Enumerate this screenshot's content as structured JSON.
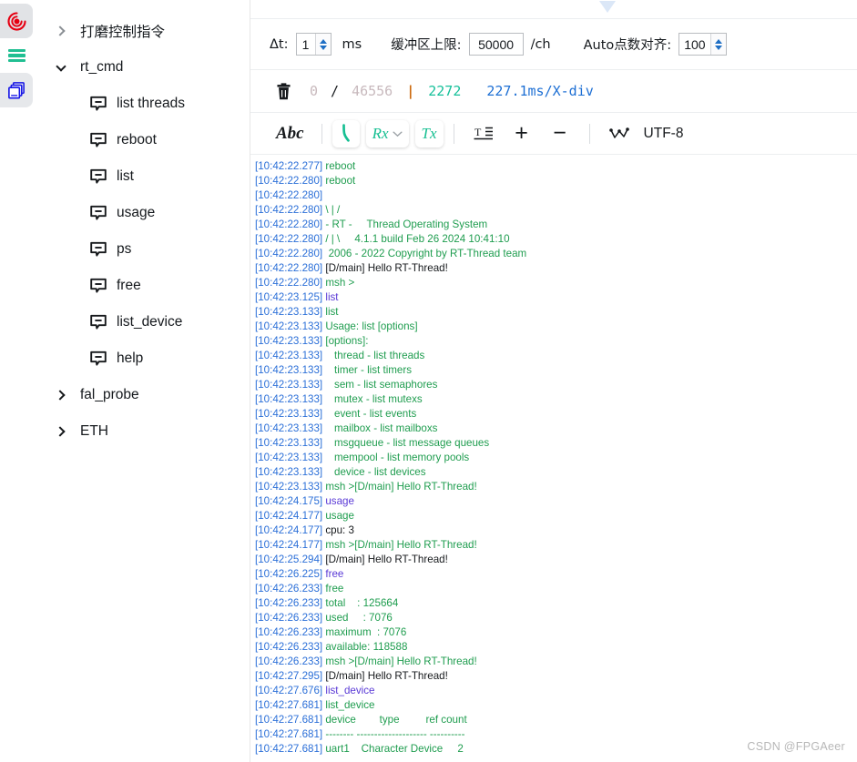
{
  "rail": {
    "items": [
      {
        "name": "record-target-icon",
        "title": "Record"
      },
      {
        "name": "menu-icon",
        "title": "Menu"
      },
      {
        "name": "layers-icon",
        "title": "Sessions"
      }
    ]
  },
  "sidebar": {
    "groups": [
      {
        "label": "打磨控制指令",
        "expanded": false,
        "children": []
      },
      {
        "label": "rt_cmd",
        "expanded": true,
        "children": [
          "list threads",
          "reboot",
          "list",
          "usage",
          "ps",
          "free",
          "list_device",
          "help"
        ]
      },
      {
        "label": "fal_probe",
        "expanded": false,
        "children": []
      },
      {
        "label": "ETH",
        "expanded": false,
        "children": []
      }
    ]
  },
  "settings_bar": {
    "dt_label": "Δt:",
    "dt_value": "1",
    "dt_unit": "ms",
    "buffer_label": "缓冲区上限:",
    "buffer_value": "50000",
    "buffer_unit": "/ch",
    "auto_label": "Auto点数对齐:",
    "auto_value": "100"
  },
  "counter_bar": {
    "trash_icon": "trash-icon",
    "current": "0",
    "slash": "/",
    "total": "46556",
    "pipe": "|",
    "selected": "2272",
    "timebase": "227.1ms/X-div"
  },
  "format_bar": {
    "abc_label": "Abc",
    "connect_icon": "phone-hook-icon",
    "rx_label": "Rx",
    "tx_label": "Tx",
    "wrap_icon": "text-align-icon",
    "zoom_in": "+",
    "zoom_out": "−",
    "plot_icon": "waveform-icon",
    "encoding": "UTF-8"
  },
  "terminal": {
    "lines": [
      {
        "ts": "[10:42:22.277]",
        "text": " reboot",
        "color": "green"
      },
      {
        "ts": "[10:42:22.280]",
        "text": " reboot",
        "color": "green"
      },
      {
        "ts": "[10:42:22.280]",
        "text": "",
        "color": "green"
      },
      {
        "ts": "[10:42:22.280]",
        "text": " \\ | /",
        "color": "green"
      },
      {
        "ts": "[10:42:22.280]",
        "text": " - RT -     Thread Operating System",
        "color": "green"
      },
      {
        "ts": "[10:42:22.280]",
        "text": " / | \\     4.1.1 build Feb 26 2024 10:41:10",
        "color": "green"
      },
      {
        "ts": "[10:42:22.280]",
        "text": "  2006 - 2022 Copyright by RT-Thread team",
        "color": "green"
      },
      {
        "ts": "[10:42:22.280]",
        "text": " [D/main] Hello RT-Thread!",
        "color": "black"
      },
      {
        "ts": "[10:42:22.280]",
        "text": " msh >",
        "color": "green"
      },
      {
        "ts": "[10:42:23.125]",
        "text": " list",
        "color": "purple"
      },
      {
        "ts": "[10:42:23.133]",
        "text": " list",
        "color": "green"
      },
      {
        "ts": "[10:42:23.133]",
        "text": " Usage: list [options]",
        "color": "green"
      },
      {
        "ts": "[10:42:23.133]",
        "text": " [options]:",
        "color": "green"
      },
      {
        "ts": "[10:42:23.133]",
        "text": "    thread - list threads",
        "color": "green"
      },
      {
        "ts": "[10:42:23.133]",
        "text": "    timer - list timers",
        "color": "green"
      },
      {
        "ts": "[10:42:23.133]",
        "text": "    sem - list semaphores",
        "color": "green"
      },
      {
        "ts": "[10:42:23.133]",
        "text": "    mutex - list mutexs",
        "color": "green"
      },
      {
        "ts": "[10:42:23.133]",
        "text": "    event - list events",
        "color": "green"
      },
      {
        "ts": "[10:42:23.133]",
        "text": "    mailbox - list mailboxs",
        "color": "green"
      },
      {
        "ts": "[10:42:23.133]",
        "text": "    msgqueue - list message queues",
        "color": "green"
      },
      {
        "ts": "[10:42:23.133]",
        "text": "    mempool - list memory pools",
        "color": "green"
      },
      {
        "ts": "[10:42:23.133]",
        "text": "    device - list devices",
        "color": "green"
      },
      {
        "ts": "[10:42:23.133]",
        "text": " msh >[D/main] Hello RT-Thread!",
        "color": "green"
      },
      {
        "ts": "[10:42:24.175]",
        "text": " usage",
        "color": "purple"
      },
      {
        "ts": "[10:42:24.177]",
        "text": " usage",
        "color": "green"
      },
      {
        "ts": "[10:42:24.177]",
        "text": " cpu: 3",
        "color": "black"
      },
      {
        "ts": "[10:42:24.177]",
        "text": " msh >[D/main] Hello RT-Thread!",
        "color": "green"
      },
      {
        "ts": "[10:42:25.294]",
        "text": " [D/main] Hello RT-Thread!",
        "color": "black"
      },
      {
        "ts": "[10:42:26.225]",
        "text": " free",
        "color": "purple"
      },
      {
        "ts": "[10:42:26.233]",
        "text": " free",
        "color": "green"
      },
      {
        "ts": "[10:42:26.233]",
        "text": " total    : 125664",
        "color": "green"
      },
      {
        "ts": "[10:42:26.233]",
        "text": " used     : 7076",
        "color": "green"
      },
      {
        "ts": "[10:42:26.233]",
        "text": " maximum  : 7076",
        "color": "green"
      },
      {
        "ts": "[10:42:26.233]",
        "text": " available: 118588",
        "color": "green"
      },
      {
        "ts": "[10:42:26.233]",
        "text": " msh >[D/main] Hello RT-Thread!",
        "color": "green"
      },
      {
        "ts": "[10:42:27.295]",
        "text": " [D/main] Hello RT-Thread!",
        "color": "black"
      },
      {
        "ts": "[10:42:27.676]",
        "text": " list_device",
        "color": "purple"
      },
      {
        "ts": "[10:42:27.681]",
        "text": " list_device",
        "color": "green"
      },
      {
        "ts": "[10:42:27.681]",
        "text": " device        type         ref count",
        "color": "green"
      },
      {
        "ts": "[10:42:27.681]",
        "text": " -------- -------------------- ----------",
        "color": "green"
      },
      {
        "ts": "[10:42:27.681]",
        "text": " uart1    Character Device     2",
        "color": "green"
      }
    ]
  },
  "watermark": {
    "text": "CSDN @FPGAeer"
  },
  "colors": {
    "accent_green": "#16bf92",
    "timestamp_blue": "#2b6fd8",
    "output_green": "#1f9d4f",
    "sent_purple": "#5a3ad6",
    "record_red": "#e60012",
    "layers_blue": "#1616e6"
  }
}
